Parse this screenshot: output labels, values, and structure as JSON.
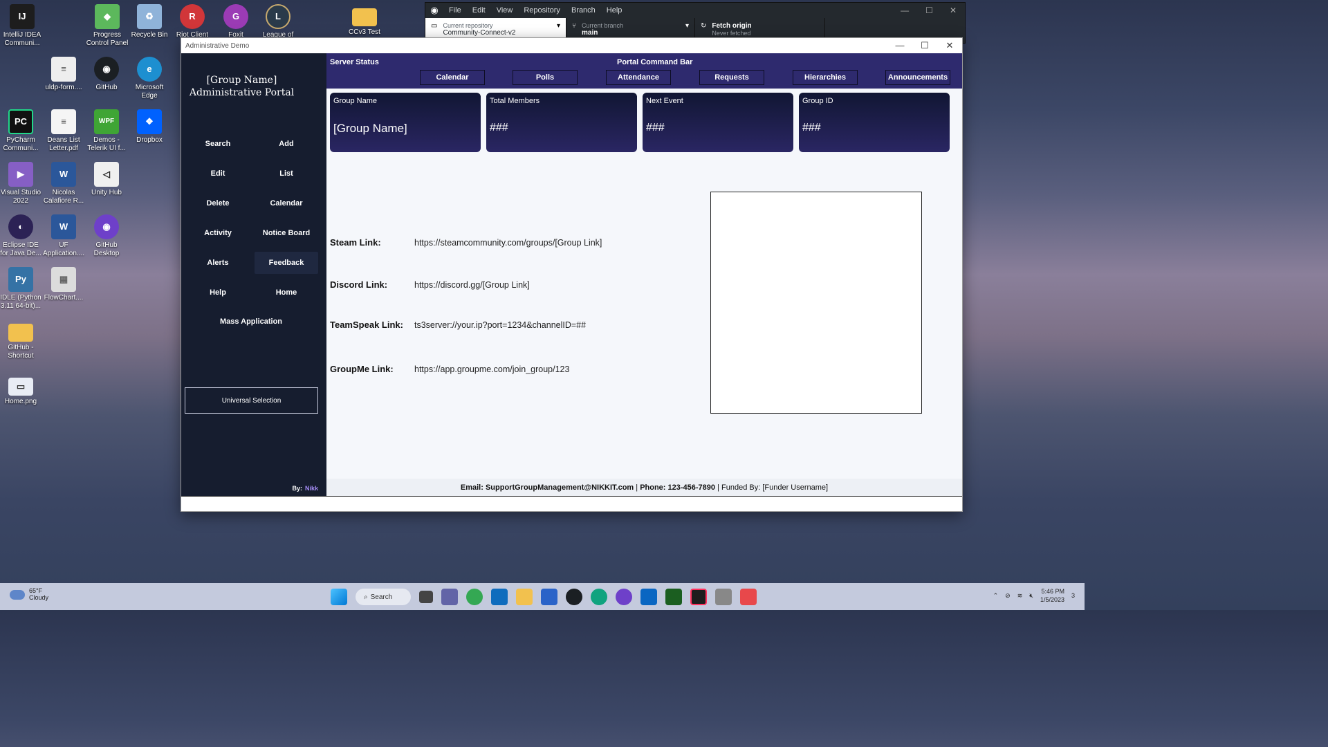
{
  "desktop": {
    "icons": [
      {
        "label": "IntelliJ IDEA Communi...",
        "color": "#1d1d1d",
        "glyph": "IJ"
      },
      {
        "label": "Progress Control Panel",
        "color": "#5cb85c",
        "glyph": "◆"
      },
      {
        "label": "Recycle Bin",
        "color": "#8fb3d9",
        "glyph": "♻"
      },
      {
        "label": "Riot Client",
        "color": "#d13639",
        "glyph": "R"
      },
      {
        "label": "Foxit",
        "color": "#9b3bb5",
        "glyph": "G"
      },
      {
        "label": "League of",
        "color": "#2a3a4a",
        "glyph": "L"
      },
      {
        "label": "CCv3 Test",
        "color": "#f2c14e",
        "glyph": ""
      },
      {
        "label": "uldp-form....",
        "color": "#eeeeee",
        "glyph": "≡"
      },
      {
        "label": "GitHub",
        "color": "#1b1f23",
        "glyph": "◉"
      },
      {
        "label": "Microsoft Edge",
        "color": "#1d8fd0",
        "glyph": "e"
      },
      {
        "label": "PyCharm Communi...",
        "color": "#21d789",
        "glyph": "PC"
      },
      {
        "label": "Deans List Letter.pdf",
        "color": "#f5f5f5",
        "glyph": "≡"
      },
      {
        "label": "Demos - Telerik UI f...",
        "color": "#3fa535",
        "glyph": "WPF"
      },
      {
        "label": "Dropbox",
        "color": "#0061fe",
        "glyph": "❖"
      },
      {
        "label": "Visual Studio 2022",
        "color": "#865fc5",
        "glyph": "▶"
      },
      {
        "label": "Nicolas Calafiore R...",
        "color": "#2b579a",
        "glyph": "W"
      },
      {
        "label": "Unity Hub",
        "color": "#f0f0f0",
        "glyph": "◁"
      },
      {
        "label": "Eclipse IDE for Java De...",
        "color": "#2c2255",
        "glyph": "◐"
      },
      {
        "label": "UF Application....",
        "color": "#2b579a",
        "glyph": "W"
      },
      {
        "label": "GitHub Desktop",
        "color": "#6e40c9",
        "glyph": "◉"
      },
      {
        "label": "IDLE (Python 3.11 64-bit)...",
        "color": "#3572a5",
        "glyph": "Py"
      },
      {
        "label": "FlowChart....",
        "color": "#dcdcdc",
        "glyph": "▦"
      },
      {
        "label": "GitHub - Shortcut",
        "color": "#f2c14e",
        "glyph": ""
      },
      {
        "label": "Home.png",
        "color": "#e8ecf5",
        "glyph": "▭"
      }
    ]
  },
  "github_desktop": {
    "menu": [
      "File",
      "Edit",
      "View",
      "Repository",
      "Branch",
      "Help"
    ],
    "current_repository_label": "Current repository",
    "current_repository_value": "Community-Connect-v2",
    "current_branch_label": "Current branch",
    "current_branch_value": "main",
    "fetch_label": "Fetch origin",
    "fetch_sub": "Never fetched"
  },
  "app": {
    "window_title": "Administrative Demo",
    "portal_title_line1": "[Group Name]",
    "portal_title_line2": "Administrative Portal",
    "nav": [
      {
        "label": "Search"
      },
      {
        "label": "Add"
      },
      {
        "label": "Edit"
      },
      {
        "label": "List"
      },
      {
        "label": "Delete"
      },
      {
        "label": "Calendar"
      },
      {
        "label": "Activity"
      },
      {
        "label": "Notice Board"
      },
      {
        "label": "Alerts"
      },
      {
        "label": "Feedback"
      },
      {
        "label": "Help"
      },
      {
        "label": "Home"
      }
    ],
    "mass_application": "Mass Application",
    "universal_selection": "Universal Selection",
    "by_label": "By:",
    "author": "Nikk",
    "server_status": "Server Status",
    "command_bar_title": "Portal Command Bar",
    "command_buttons": [
      "Calendar",
      "Polls",
      "Attendance",
      "Requests",
      "Hierarchies",
      "Announcements"
    ],
    "cards": [
      {
        "label": "Group Name",
        "value": "[Group Name]"
      },
      {
        "label": "Total Members",
        "value": "###"
      },
      {
        "label": "Next Event",
        "value": "###"
      },
      {
        "label": "Group ID",
        "value": "###"
      }
    ],
    "links": [
      {
        "label": "Steam Link:",
        "value": "https://steamcommunity.com/groups/[Group Link]"
      },
      {
        "label": "Discord Link:",
        "value": "https://discord.gg/[Group Link]"
      },
      {
        "label": "TeamSpeak Link:",
        "value": "ts3server://your.ip?port=1234&channelID=##"
      },
      {
        "label": "GroupMe Link:",
        "value": "https://app.groupme.com/join_group/123"
      }
    ],
    "footer": {
      "email": "Email: SupportGroupManagement@NIKKIT.com",
      "phone": "Phone: 123-456-7890",
      "funded_label": "Funded By:",
      "funder": "[Funder Username]"
    }
  },
  "taskbar": {
    "temperature": "65°F",
    "weather": "Cloudy",
    "search_label": "Search",
    "time": "5:46 PM",
    "date": "1/5/2023",
    "notification_count": "3"
  },
  "colors": {
    "sidebar_bg": "#161d2f",
    "command_bar_bg": "#2e2a6e",
    "author_accent": "#a48cf5"
  }
}
